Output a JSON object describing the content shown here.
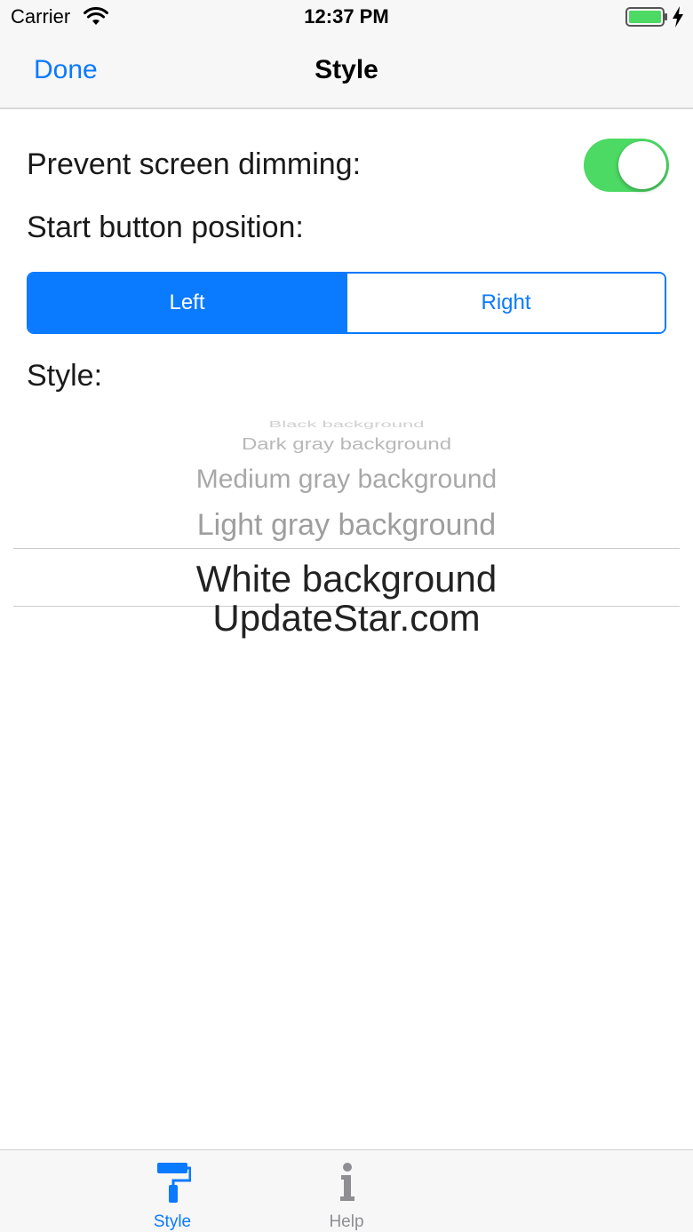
{
  "status_bar": {
    "carrier": "Carrier",
    "time": "12:37 PM",
    "icons": [
      "wifi-icon",
      "battery-icon",
      "charging-icon"
    ]
  },
  "nav": {
    "done_label": "Done",
    "title": "Style"
  },
  "settings": {
    "dimming_label": "Prevent screen dimming:",
    "dimming_on": true,
    "position_label": "Start button position:",
    "position_options": [
      "Left",
      "Right"
    ],
    "position_selected": "Left",
    "style_label": "Style:"
  },
  "picker": {
    "items": [
      "Black background",
      "Dark gray background",
      "Medium gray background",
      "Light gray background",
      "White background"
    ],
    "selected": "White background"
  },
  "watermark": "UpdateStar.com",
  "tab_bar": {
    "tabs": [
      {
        "label": "Style",
        "icon": "paint-roller-icon",
        "active": true
      },
      {
        "label": "Help",
        "icon": "info-icon",
        "active": false
      }
    ]
  },
  "colors": {
    "accent": "#0a7aff",
    "toggle_on": "#4cd964",
    "inactive_tab": "#8e8e93"
  }
}
